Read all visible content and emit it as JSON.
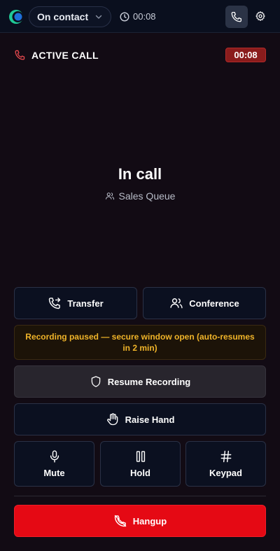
{
  "topbar": {
    "status_label": "On contact",
    "timer": "00:08"
  },
  "call": {
    "header_label": "ACTIVE CALL",
    "timer_badge": "00:08",
    "state_title": "In call",
    "queue_name": "Sales Queue"
  },
  "actions": {
    "transfer_label": "Transfer",
    "conference_label": "Conference",
    "recording_notice": "Recording paused — secure window open (auto-resumes in 2 min)",
    "resume_label": "Resume Recording",
    "raise_label": "Raise Hand",
    "mute_label": "Mute",
    "hold_label": "Hold",
    "keypad_label": "Keypad",
    "hangup_label": "Hangup"
  },
  "colors": {
    "background": "#120b14",
    "topbar": "#0a0f1e",
    "hangup": "#e50914",
    "timer_badge": "#8a1c1c",
    "notice_text": "#f0b429"
  },
  "icons": {
    "logo": "app-logo",
    "status_chevron": "chevron-down-icon",
    "timer": "clock-icon",
    "phone": "phone-icon",
    "settings": "gear-icon",
    "active_call": "phone-red-icon",
    "queue": "users-icon",
    "transfer": "phone-forward-icon",
    "conference": "users-icon",
    "resume": "shield-icon",
    "raise": "hand-icon",
    "mute": "mic-icon",
    "hold": "pause-icon",
    "keypad": "hash-icon",
    "hangup": "phone-off-icon"
  }
}
